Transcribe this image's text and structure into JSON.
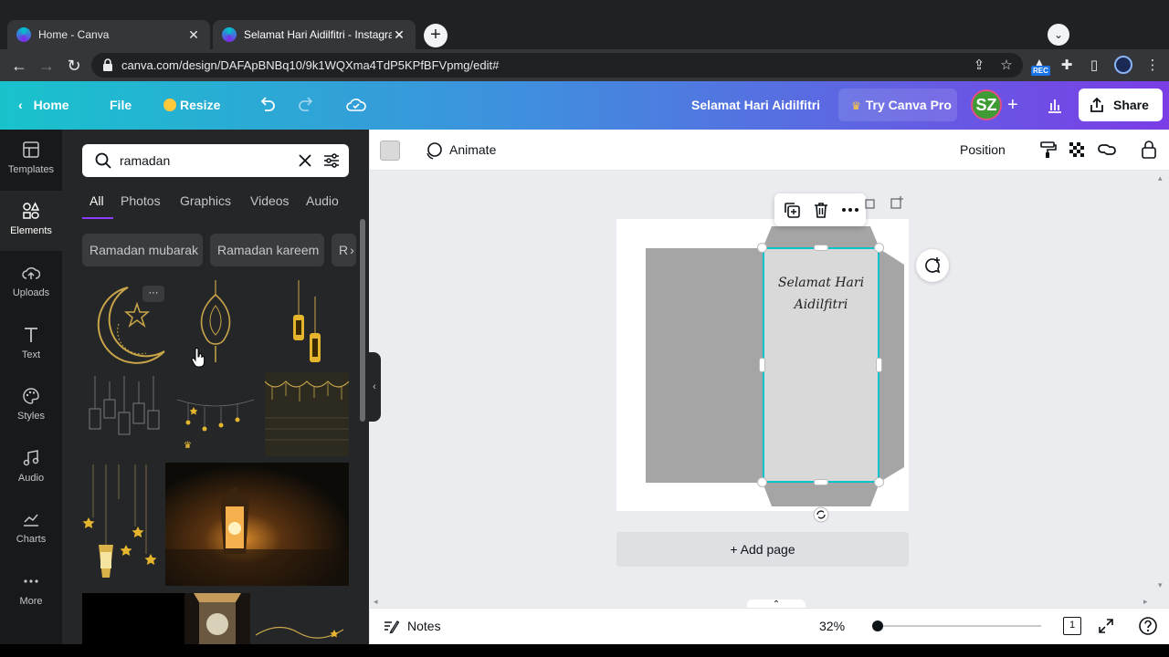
{
  "browser": {
    "tabs": [
      {
        "title": "Home - Canva",
        "close": "✕"
      },
      {
        "title": "Selamat Hari Aidilfitri - Instagram",
        "close": "✕"
      }
    ],
    "new_tab": "+",
    "url": "canva.com/design/DAFApBNBq10/9k1WQXma4TdP5KPfBFVpmg/edit#",
    "rec_badge": "REC"
  },
  "header": {
    "home": "Home",
    "file": "File",
    "resize": "Resize",
    "design_title": "Selamat Hari Aidilfitri",
    "try_pro": "Try Canva Pro",
    "avatar_initials": "SZ",
    "add": "+",
    "share": "Share"
  },
  "rail": {
    "items": [
      {
        "label": "Templates"
      },
      {
        "label": "Elements"
      },
      {
        "label": "Uploads"
      },
      {
        "label": "Text"
      },
      {
        "label": "Styles"
      },
      {
        "label": "Audio"
      },
      {
        "label": "Charts"
      },
      {
        "label": "More"
      }
    ]
  },
  "panel": {
    "search_value": "ramadan",
    "tabs": [
      "All",
      "Photos",
      "Graphics",
      "Videos",
      "Audio"
    ],
    "chips": [
      "Ramadan mubarak",
      "Ramadan kareem",
      "R"
    ],
    "more_dots": "···"
  },
  "toolbar": {
    "animate": "Animate",
    "position": "Position"
  },
  "canvas": {
    "card_text_line1": "Selamat Hari",
    "card_text_line2": "Aidilfitri",
    "add_page": "+ Add page"
  },
  "footer": {
    "notes": "Notes",
    "zoom": "32%",
    "page_count": "1"
  },
  "colors": {
    "accent": "#00c4cc",
    "brand_purple": "#7d2ae8",
    "selection": "#00c4cc"
  }
}
